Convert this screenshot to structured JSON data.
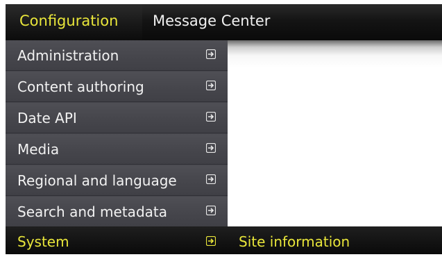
{
  "top_nav": {
    "configuration_label": "Configuration",
    "message_center_label": "Message Center"
  },
  "menu": {
    "items": [
      {
        "label": "Administration"
      },
      {
        "label": "Content authoring"
      },
      {
        "label": "Date API"
      },
      {
        "label": "Media"
      },
      {
        "label": "Regional and language"
      },
      {
        "label": "Search and metadata"
      },
      {
        "label": "System"
      }
    ],
    "arrow_icon": "arrow-right-box-icon"
  },
  "submenu": {
    "active_item_label": "Site information"
  },
  "colors": {
    "accent_yellow": "#e9e63a",
    "menu_bg": "#45454b",
    "bar_bg": "#111111",
    "text_light": "#f2f2f2"
  }
}
